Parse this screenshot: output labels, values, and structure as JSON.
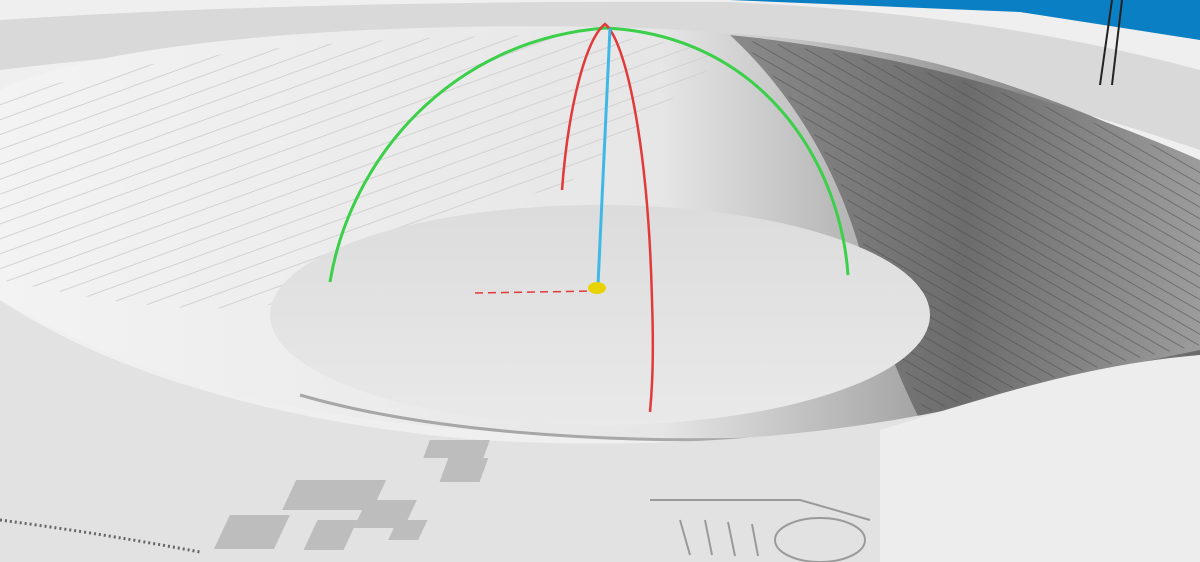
{
  "viewport": {
    "background_color": "#0a7fc4",
    "terrain_light": "#efefef",
    "terrain_shadow": "#5a5a5a"
  },
  "gizmo": {
    "axis_colors": {
      "x_axis_arc": "#e23a3a",
      "y_axis_arc": "#3ccf4a",
      "z_axis_line": "#3fb8e6",
      "pivot": "#e8d300"
    }
  },
  "structures": {
    "color": "#bdbdbd"
  }
}
